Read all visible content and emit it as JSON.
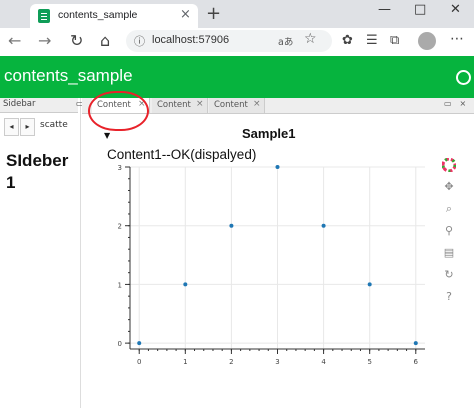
{
  "browser": {
    "tab_title": "contents_sample",
    "tab_close": "×",
    "new_tab": "+",
    "address": "localhost:57906",
    "read_aloud": "aあ",
    "window_controls": [
      "—",
      "□",
      "✕"
    ]
  },
  "app": {
    "title": "contents_sample",
    "sidebar": {
      "tab_label": "Sidebar",
      "scroll_left": "◂",
      "scroll_right": "▸",
      "subtab_label": "scatte",
      "heading": "SIdeber 1"
    },
    "content_tabs": [
      {
        "label": "Content",
        "close": "×"
      },
      {
        "label": "Content",
        "close": "×"
      },
      {
        "label": "Content",
        "close": "×"
      }
    ],
    "section_toggle": "▼",
    "message": "Content1--OK(dispalyed)",
    "plot_tools": [
      "bokeh-logo-icon",
      "pan-icon",
      "box-zoom-icon",
      "wheel-zoom-icon",
      "save-icon",
      "reset-icon",
      "help-icon"
    ]
  },
  "chart_data": {
    "type": "scatter",
    "title": "Sample1",
    "x": [
      0,
      1,
      2,
      3,
      4,
      5,
      6
    ],
    "y": [
      0,
      1,
      2,
      3,
      2,
      1,
      0
    ],
    "xlim": [
      -0.2,
      6.2
    ],
    "ylim": [
      -0.1,
      3.0
    ],
    "xticks": [
      "0",
      "1",
      "2",
      "3",
      "4",
      "5",
      "6"
    ],
    "yticks": [
      "0",
      "1",
      "2",
      "3"
    ],
    "xlabel": "",
    "ylabel": "",
    "grid": true,
    "point_color": "#1f77b4"
  }
}
